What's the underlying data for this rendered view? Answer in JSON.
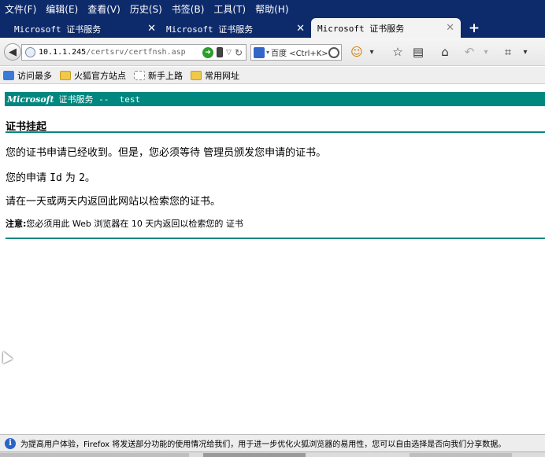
{
  "menubar": {
    "items": [
      "文件(F)",
      "编辑(E)",
      "查看(V)",
      "历史(S)",
      "书签(B)",
      "工具(T)",
      "帮助(H)"
    ]
  },
  "tabs": [
    {
      "title": "Microsoft 证书服务",
      "close": "✕",
      "active": false
    },
    {
      "title": "Microsoft 证书服务",
      "close": "✕",
      "active": false
    },
    {
      "title": "Microsoft 证书服务",
      "close": "✕",
      "active": true
    }
  ],
  "new_tab_label": "+",
  "navbar": {
    "back_icon": "back-arrow-icon",
    "url_host": "10.1.1.245",
    "url_path": "/certsrv/certfnsh.asp",
    "search_placeholder": "百度 <Ctrl+K>",
    "search_engine_icon": "baidu-icon"
  },
  "bookmarks": [
    {
      "label": "访问最多",
      "icon": "blue"
    },
    {
      "label": "火狐官方站点",
      "icon": "folder"
    },
    {
      "label": "新手上路",
      "icon": "dotted"
    },
    {
      "label": "常用网址",
      "icon": "folder"
    }
  ],
  "page": {
    "banner_brand": "Microsoft",
    "banner_rest": "证书服务 --  test",
    "title": "证书挂起",
    "para1": "您的证书申请已经收到。但是，您必须等待 管理员颁发您申请的证书。",
    "para2_prefix": "您的申请 ",
    "para2_code": "Id",
    "para2_mid": " 为 ",
    "para2_num": "2",
    "para2_suffix": "。",
    "para3": "请在一天或两天内返回此网站以检索您的证书。",
    "note_label": "注意:",
    "note_text": "您必须用此 Web 浏览器在 10 天内返回以检索您的 证书"
  },
  "notification": {
    "text": "为提高用户体验，Firefox 将发送部分功能的使用情况给我们，用于进一步优化火狐浏览器的易用性，您可以自由选择是否向我们分享数据。"
  },
  "colors": {
    "chrome_bg": "#0d2a6b",
    "banner_bg": "#00877f",
    "info_blue": "#2a64c7"
  }
}
